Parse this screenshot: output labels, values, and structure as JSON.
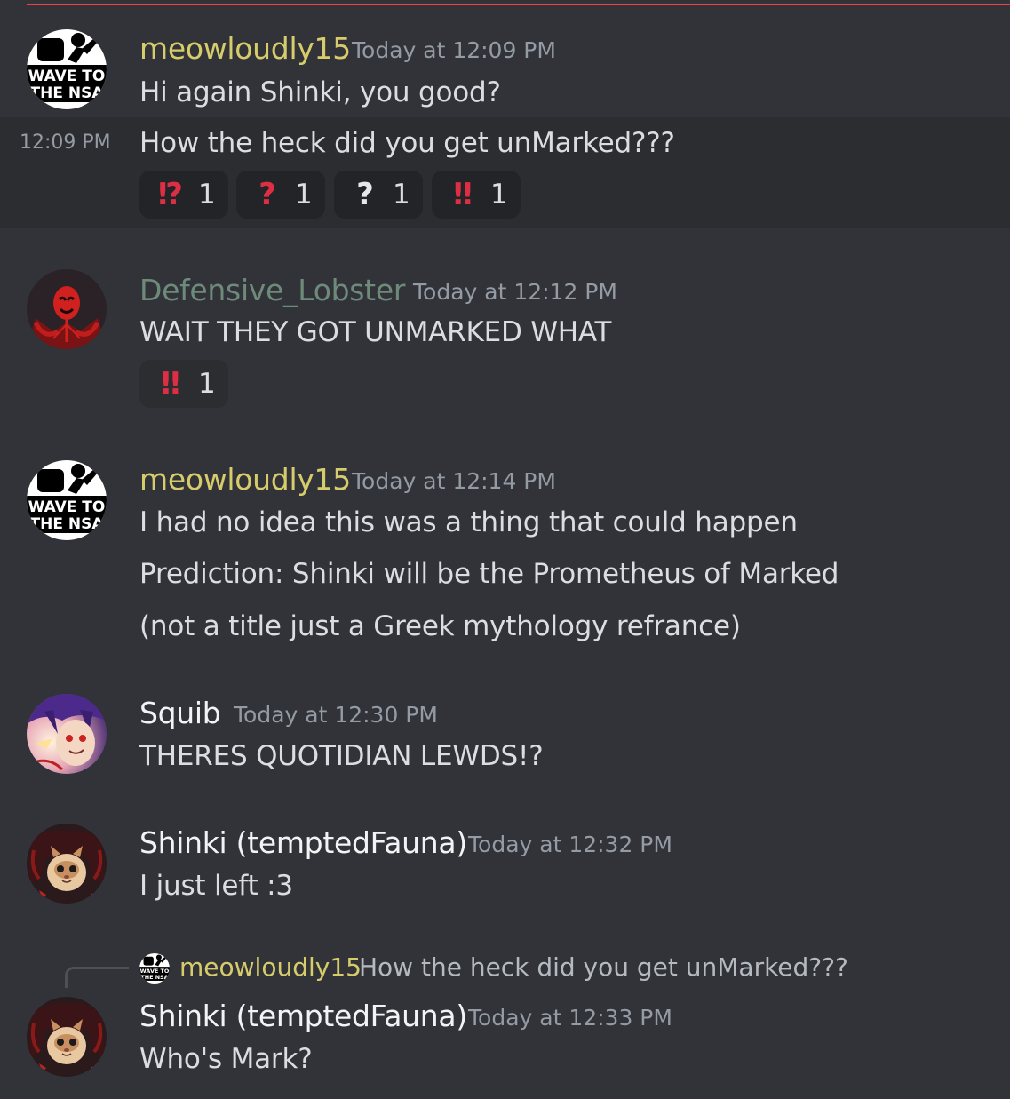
{
  "colors": {
    "background": "#313338",
    "highlight": "#2b2d31",
    "new_divider": "#f23f43",
    "meowloudly_name": "#d7cc6b",
    "lobster_name": "#6d8a7a",
    "default_name": "#f2f3f5",
    "timestamp": "#949ba4",
    "reaction_red": "#dd2e44",
    "reaction_white": "#e6e7e8"
  },
  "messages": [
    {
      "author": "meowloudly15",
      "timestamp": "Today at 12:09 PM",
      "avatar": "wave-to-the-nsa",
      "avatar_text": "WAVE TO THE NSA",
      "lines": [
        "Hi again Shinki, you good?"
      ]
    },
    {
      "side_timestamp": "12:09 PM",
      "lines": [
        "How the heck did you get unMarked???"
      ],
      "reactions": [
        {
          "emoji": "⁉",
          "icon": "interrobang-icon",
          "count": "1"
        },
        {
          "emoji": "?",
          "icon": "red-question-icon",
          "count": "1"
        },
        {
          "emoji": "?",
          "icon": "white-question-icon",
          "count": "1"
        },
        {
          "emoji": "‼",
          "icon": "double-exclamation-icon",
          "count": "1"
        }
      ]
    },
    {
      "author": "Defensive_Lobster",
      "timestamp": "Today at 12:12 PM",
      "avatar": "red-masked-figure",
      "lines": [
        "WAIT THEY GOT UNMARKED WHAT"
      ],
      "reactions": [
        {
          "emoji": "‼",
          "icon": "double-exclamation-icon",
          "count": "1"
        }
      ]
    },
    {
      "author": "meowloudly15",
      "timestamp": "Today at 12:14 PM",
      "avatar": "wave-to-the-nsa",
      "avatar_text": "WAVE TO THE NSA",
      "lines": [
        "I had no idea this was a thing that could happen",
        "Prediction: Shinki will be the Prometheus of Marked",
        "(not a title just a Greek mythology refrance)"
      ]
    },
    {
      "author": "Squib",
      "timestamp": "Today at 12:30 PM",
      "avatar": "anime-character",
      "lines": [
        "THERES QUOTIDIAN LEWDS!?"
      ]
    },
    {
      "author": "Shinki (temptedFauna)",
      "timestamp": "Today at 12:32 PM",
      "avatar": "cat-face",
      "lines": [
        "I just left :3"
      ]
    },
    {
      "reply_to": {
        "author": "meowloudly15",
        "text": "How the heck did you get unMarked???"
      },
      "author": "Shinki (temptedFauna)",
      "timestamp": "Today at 12:33 PM",
      "avatar": "cat-face",
      "lines": [
        "Who's Mark?"
      ]
    }
  ]
}
